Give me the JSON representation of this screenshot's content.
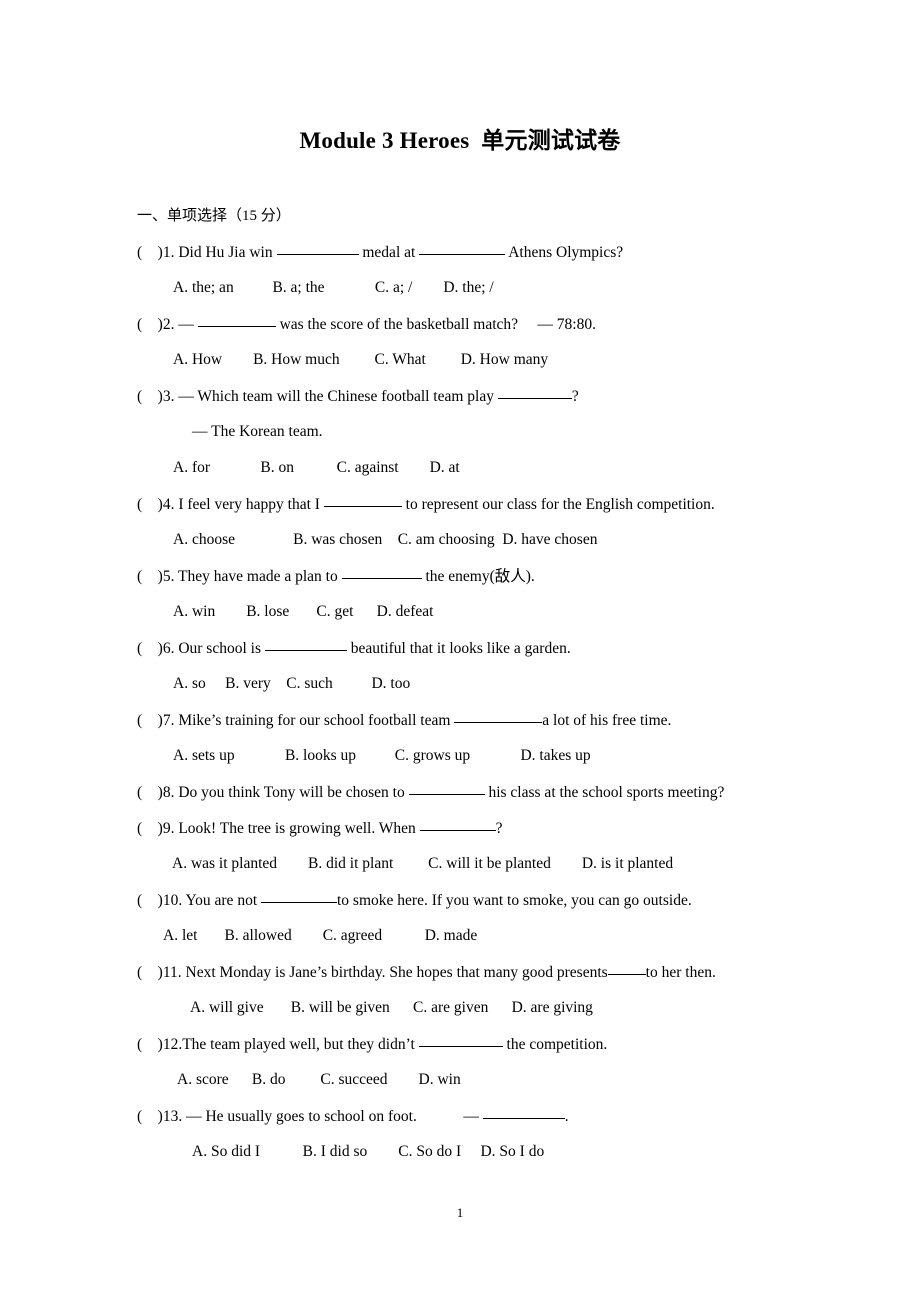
{
  "document": {
    "title": "Module 3 Heroes  单元测试试卷",
    "page_number": "1"
  },
  "sections": [
    {
      "heading": "一、单项选择（15 分）"
    }
  ],
  "questions": [
    {
      "marker": "(    )1.",
      "stem_a": " Did Hu Jia win ",
      "stem_b": " medal at ",
      "stem_c": " Athens Olympics?",
      "options": "A. the; an          B. a; the             C. a; /        D. the; /"
    },
    {
      "marker": "(    )2.",
      "stem_a": " — ",
      "stem_b": " was the score of the basketball match?     — 78:80.",
      "options": "A. How        B. How much         C. What         D. How many"
    },
    {
      "marker": "(    )3.",
      "stem_a": " — Which team will the Chinese football team play ",
      "stem_b": "?",
      "continuation": "— The Korean team.",
      "options": "A. for             B. on           C. against        D. at"
    },
    {
      "marker": "(    )4.",
      "stem_a": " I feel very happy that I ",
      "stem_b": " to represent our class for the English competition.",
      "options": "A. choose               B. was chosen    C. am choosing  D. have chosen"
    },
    {
      "marker": "(    )5.",
      "stem_a": " They have made a plan to ",
      "stem_b": " the enemy(敌人).",
      "options": "A. win        B. lose       C. get      D. defeat"
    },
    {
      "marker": "(    )6.",
      "stem_a": " Our school is ",
      "stem_b": " beautiful that it looks like a garden.",
      "options": "A. so     B. very    C. such          D. too"
    },
    {
      "marker": "(    )7.",
      "stem_a": " Mike’s training for our school football team ",
      "stem_b": "a lot of his free time.",
      "options": "A. sets up             B. looks up          C. grows up             D. takes up"
    },
    {
      "marker": "(    )8.",
      "stem_a": " Do you think Tony will be chosen to ",
      "stem_b": " his class at the school sports meeting?",
      "options": ""
    },
    {
      "marker": "(    )9.",
      "stem_a": " Look! The tree is growing well. When ",
      "stem_b": "?",
      "options": "A. was it planted        B. did it plant         C. will it be planted        D. is it planted"
    },
    {
      "marker": "(    )10.",
      "stem_a": " You are not ",
      "stem_b": "to smoke here. If you want to smoke, you can go outside.",
      "options": "A. let       B. allowed        C. agreed           D. made"
    },
    {
      "marker": "(    )11.",
      "stem_a": " Next Monday is Jane’s birthday. She hopes that many good presents",
      "stem_b": "to her then.",
      "options": "A. will give       B. will be given      C. are given      D. are giving"
    },
    {
      "marker": "(    )12.",
      "stem_a": "The team played well, but they didn’t ",
      "stem_b": " the competition.",
      "options": "A. score      B. do         C. succeed        D. win"
    },
    {
      "marker": "(    )13.",
      "stem_a": " — He usually goes to school on foot.            — ",
      "stem_b": ".",
      "options": "A. So did I           B. I did so        C. So do I     D. So I do"
    }
  ]
}
